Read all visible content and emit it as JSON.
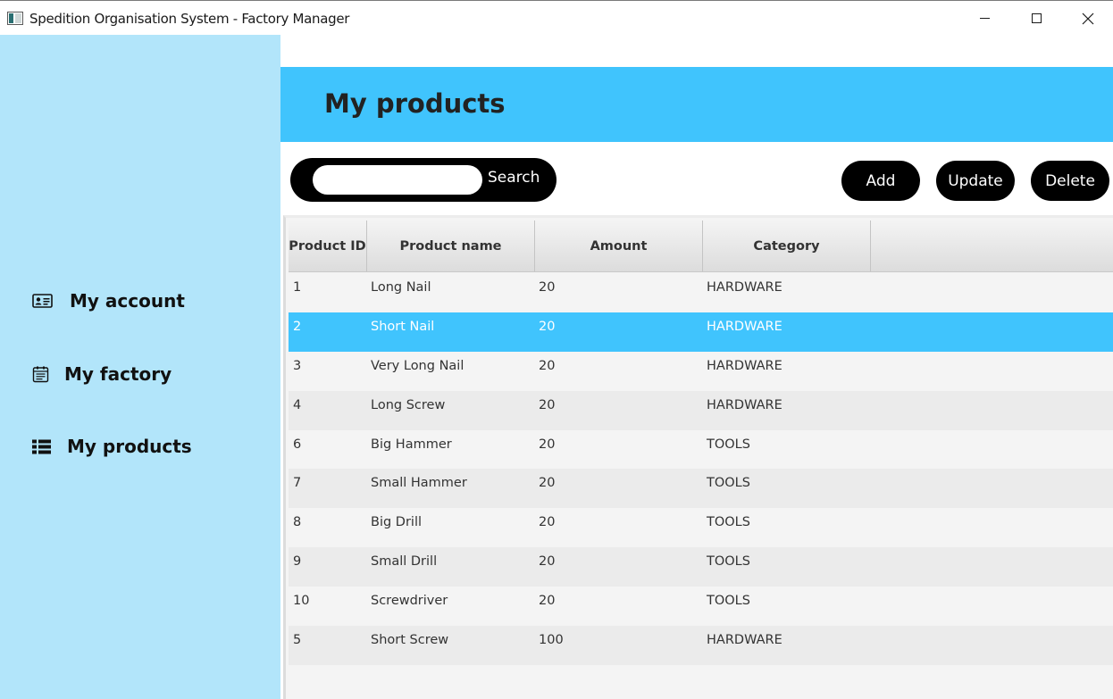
{
  "window": {
    "title": "Spedition Organisation System - Factory Manager"
  },
  "sidebar": {
    "items": [
      {
        "label": "My account",
        "icon": "id-card-icon"
      },
      {
        "label": "My factory",
        "icon": "factory-list-icon"
      },
      {
        "label": "My products",
        "icon": "list-icon"
      }
    ]
  },
  "header": {
    "title": "My products"
  },
  "toolbar": {
    "search_value": "",
    "search_label": "Search",
    "add_label": "Add",
    "update_label": "Update",
    "delete_label": "Delete"
  },
  "table": {
    "columns": [
      "Product ID",
      "Product name",
      "Amount",
      "Category"
    ],
    "rows": [
      [
        "1",
        "Long Nail",
        "20",
        "HARDWARE"
      ],
      [
        "2",
        "Short Nail",
        "20",
        "HARDWARE"
      ],
      [
        "3",
        "Very Long Nail",
        "20",
        "HARDWARE"
      ],
      [
        "4",
        "Long Screw",
        "20",
        "HARDWARE"
      ],
      [
        "6",
        "Big Hammer",
        "20",
        "TOOLS"
      ],
      [
        "7",
        "Small Hammer",
        "20",
        "TOOLS"
      ],
      [
        "8",
        "Big Drill",
        "20",
        "TOOLS"
      ],
      [
        "9",
        "Small Drill",
        "20",
        "TOOLS"
      ],
      [
        "10",
        "Screwdriver",
        "20",
        "TOOLS"
      ],
      [
        "5",
        "Short Screw",
        "100",
        "HARDWARE"
      ]
    ],
    "selected_row": 1
  },
  "colors": {
    "accent": "#40c4fd",
    "sidebar": "#b2e5fa",
    "button": "#000000"
  }
}
